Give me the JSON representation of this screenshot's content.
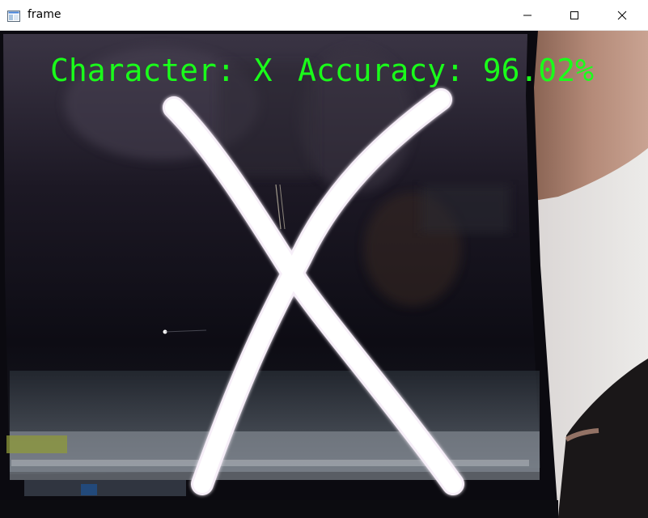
{
  "window": {
    "title": "frame",
    "controls": {
      "minimize": "minimize-icon",
      "maximize": "maximize-icon",
      "close": "close-icon"
    }
  },
  "overlay": {
    "character_text": "Character: X",
    "accuracy_text": "Accuracy: 96.02%",
    "text_color": "#1aff1a"
  },
  "recognition": {
    "character": "X",
    "accuracy_percent": 96.02
  }
}
